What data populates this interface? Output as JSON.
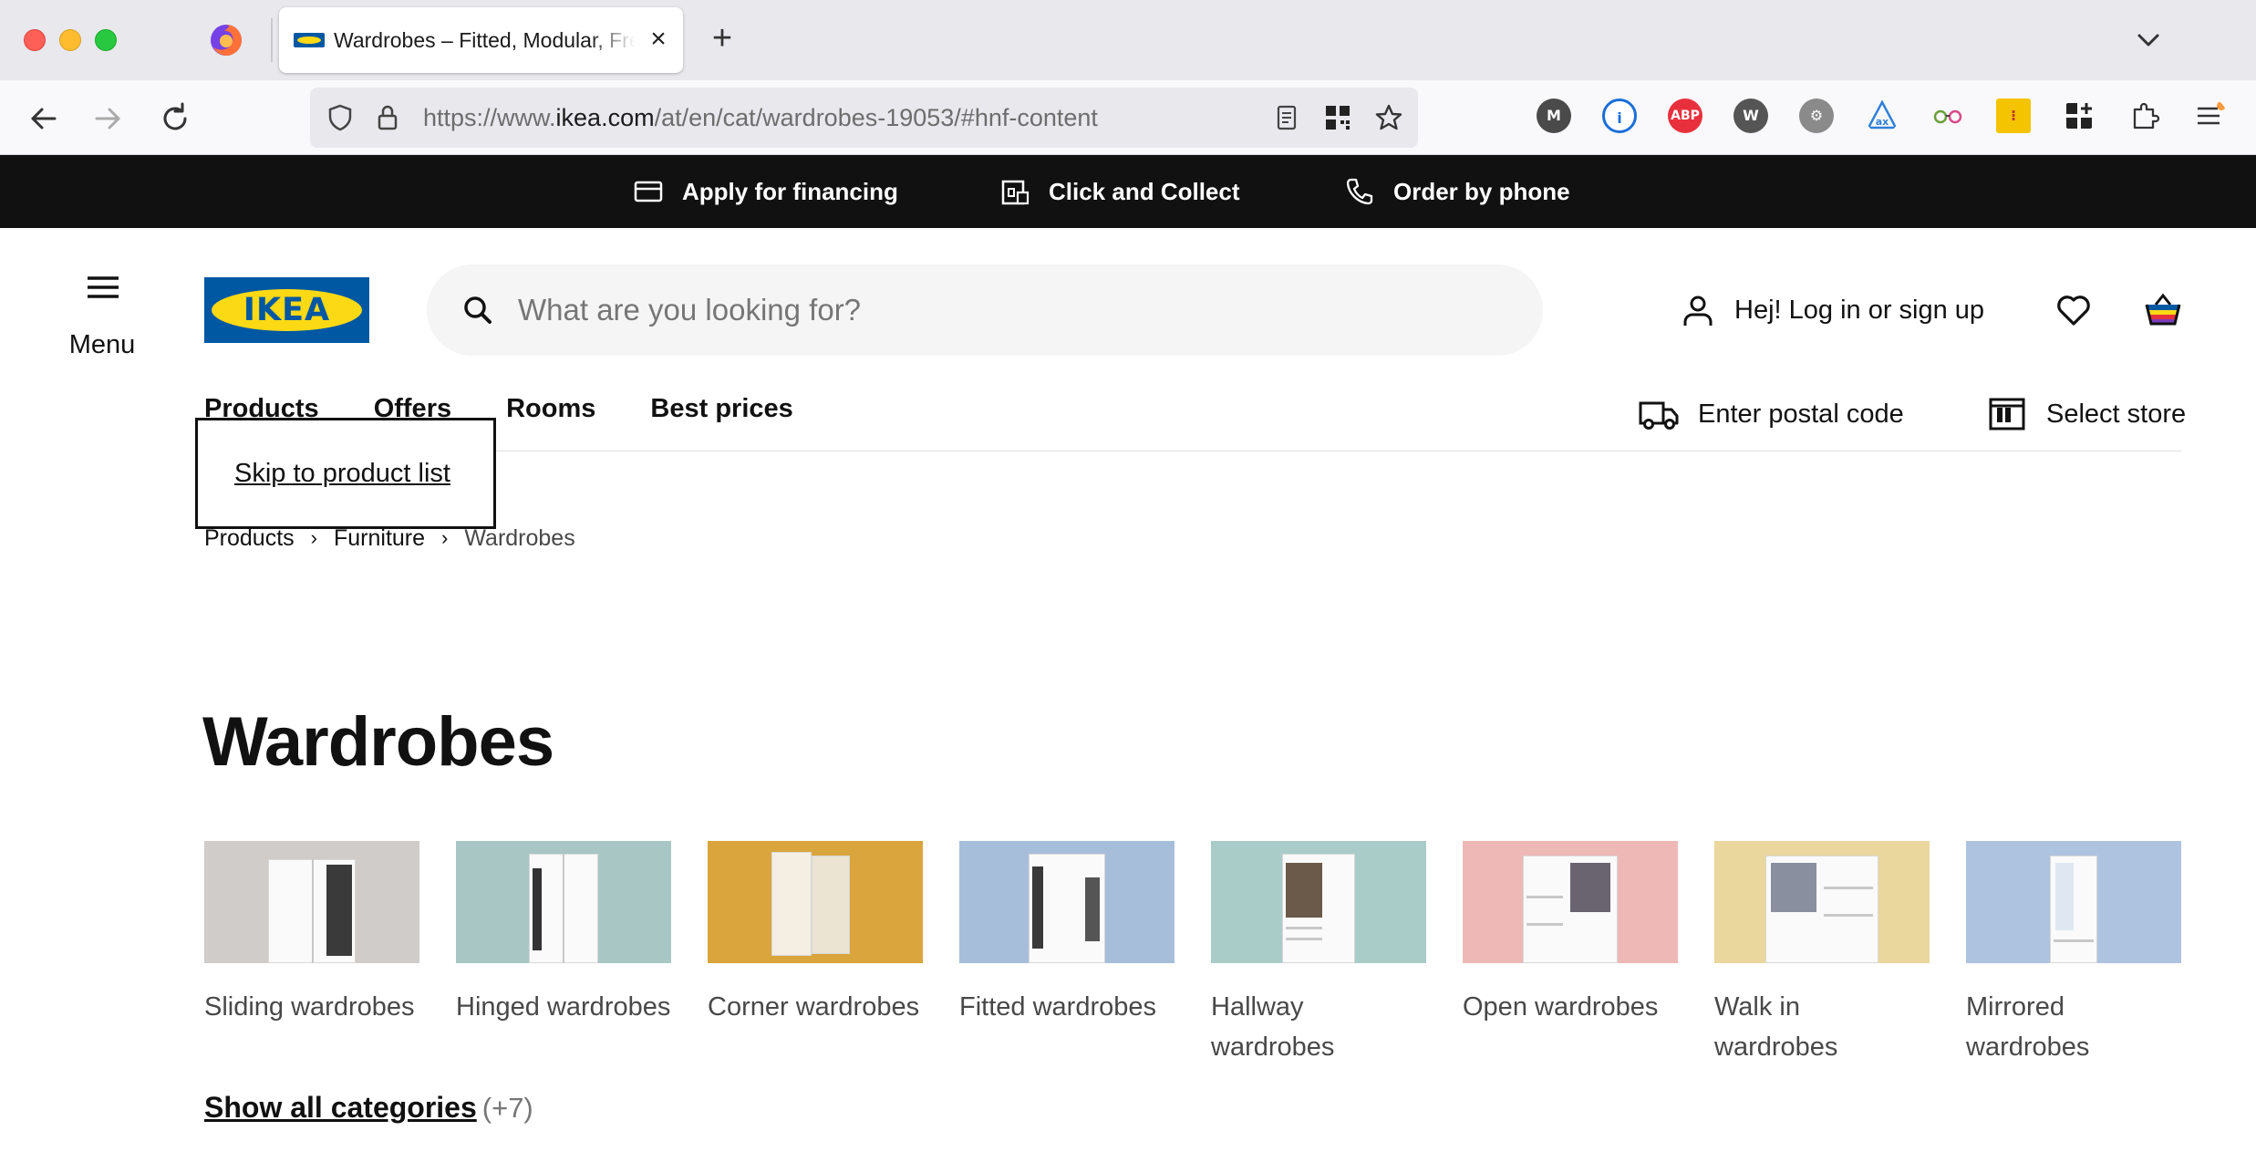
{
  "browser": {
    "tab_title": "Wardrobes – Fitted, Modular, Free-standing - IKEA",
    "url_prefix": "https://www.",
    "url_host": "ikea.com",
    "url_path": "/at/en/cat/wardrobes-19053/#hnf-content",
    "extensions": [
      {
        "name": "m-extension-icon",
        "label": "M",
        "color": "#4a4a4a"
      },
      {
        "name": "onepassword-icon",
        "label": "",
        "color": "#1a6fd8"
      },
      {
        "name": "adblock-plus-icon",
        "label": "ABP",
        "color": "#e8303c"
      },
      {
        "name": "w-extension-icon",
        "label": "W",
        "color": "#555555"
      },
      {
        "name": "gear-extension-icon",
        "label": "",
        "color": "#777777"
      },
      {
        "name": "ax-extension-icon",
        "label": "",
        "color": "#2f7fd9"
      },
      {
        "name": "glasses-extension-icon",
        "label": "",
        "color": "#6a9f3a"
      },
      {
        "name": "yellow-extension-icon",
        "label": "",
        "color": "#f4c400"
      },
      {
        "name": "grid-plus-extension-icon",
        "label": "",
        "color": "#222222"
      }
    ]
  },
  "promo": {
    "financing": "Apply for financing",
    "click_collect": "Click and Collect",
    "phone": "Order by phone"
  },
  "header": {
    "menu_label": "Menu",
    "logo_text": "IKEA",
    "search_placeholder": "What are you looking for?",
    "login_label": "Hej! Log in or sign up",
    "colors": {
      "brand_blue": "#0058a3",
      "brand_yellow": "#fbd914"
    }
  },
  "nav": {
    "items": [
      "Products",
      "Offers",
      "Rooms",
      "Best prices"
    ],
    "postal_code": "Enter postal code",
    "select_store": "Select store"
  },
  "skip_link": "Skip to product list",
  "breadcrumb": [
    "Products",
    "Furniture",
    "Wardrobes"
  ],
  "page_title": "Wardrobes",
  "categories": [
    {
      "label": "Sliding wardrobes",
      "bg": "#cfccca"
    },
    {
      "label": "Hinged wardrobes",
      "bg": "#a8c7c4"
    },
    {
      "label": "Corner wardrobes",
      "bg": "#d9a53c"
    },
    {
      "label": "Fitted wardrobes",
      "bg": "#a7bedb"
    },
    {
      "label": "Hallway wardrobes",
      "bg": "#a9ccc9"
    },
    {
      "label": "Open wardrobes",
      "bg": "#eeb8b6"
    },
    {
      "label": "Walk in wardrobes",
      "bg": "#ead79e"
    },
    {
      "label": "Mirrored wardrobes",
      "bg": "#aec3df"
    }
  ],
  "show_all": {
    "label": "Show all categories",
    "count": "(+7)"
  }
}
